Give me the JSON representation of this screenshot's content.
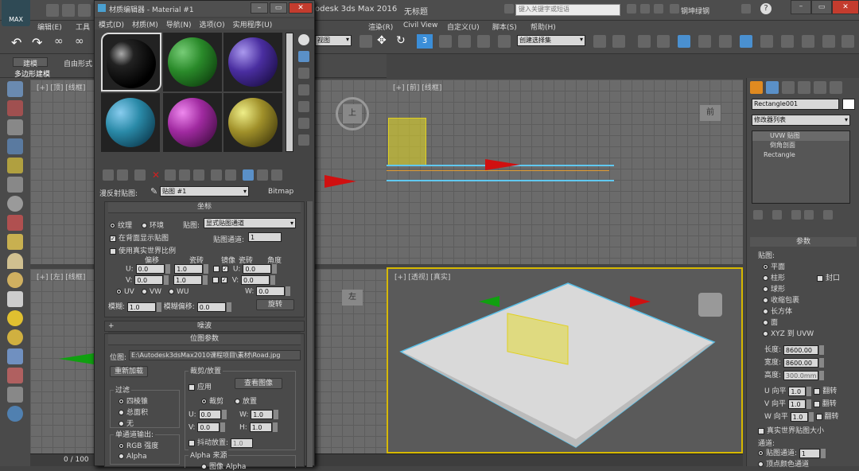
{
  "app": {
    "title_partial": "odesk 3ds Max 2016",
    "doc_title": "无标题",
    "search_placeholder": "键入关键字或短语",
    "user": "钢坤绿钢",
    "logo": "MAX"
  },
  "main_menu": [
    "编辑(E)",
    "工具",
    "渲染(R)",
    "Civil View",
    "自定义(U)",
    "脚本(S)",
    "帮助(H)"
  ],
  "main_toolbar": {
    "view_dropdown": "视图",
    "selection_set": "创建选择集"
  },
  "ribbon": {
    "tab_build": "建模",
    "tab_freeform": "自由形式",
    "poly_label": "多边形建模"
  },
  "viewports": {
    "top": "[+] [顶] [线框]",
    "front": "[+] [前] [线框]",
    "left": "[+] [左] [线框]",
    "persp": "[+] [透视] [真实]"
  },
  "viewcube": {
    "top": "上",
    "front": "前",
    "left": "左"
  },
  "timeline": "0 / 100",
  "mat_editor": {
    "title": "材质编辑器 - Material #1",
    "menu": [
      "模式(D)",
      "材质(M)",
      "导航(N)",
      "选项(O)",
      "实用程序(U)"
    ],
    "map_label": "漫反射贴图:",
    "map_name": "贴图 #1",
    "map_type": "Bitmap",
    "coords": {
      "header": "坐标",
      "texture": "纹理",
      "env": "环境",
      "mapping_label": "贴图:",
      "mapping_value": "显式贴图通道",
      "show_back": "在背面显示贴图",
      "channel_label": "贴图通道:",
      "channel_value": "1",
      "real_world": "使用真实世界比例",
      "h_offset": "偏移",
      "h_tiling": "瓷砖",
      "h_mirror": "镜像",
      "h_tile": "瓷砖",
      "h_angle": "角度",
      "u": "U:",
      "v": "V:",
      "w": "W:",
      "u_offset": "0.0",
      "v_offset": "0.0",
      "u_tiling": "1.0",
      "v_tiling": "1.0",
      "u_angle": "0.0",
      "v_angle": "0.0",
      "w_angle": "0.0",
      "uv": "UV",
      "vw": "VW",
      "wu": "WU",
      "blur_label": "模糊:",
      "blur_value": "1.0",
      "blur_offset_label": "模糊偏移:",
      "blur_offset_value": "0.0",
      "rotate_btn": "旋转"
    },
    "noise_header": "噪波",
    "bitmap": {
      "header": "位图参数",
      "path_label": "位图:",
      "path": "E:\\Autodesk3dsMax2010课程项目\\素材\\Road.jpg",
      "reload": "重新加载",
      "crop_group": "裁剪/放置",
      "apply": "应用",
      "view_image": "查看图像",
      "crop": "裁剪",
      "place": "放置",
      "u": "U:",
      "v": "V:",
      "w": "W:",
      "h": "H:",
      "u_val": "0.0",
      "v_val": "0.0",
      "w_val": "1.0",
      "h_val": "1.0",
      "jitter": "抖动放置:",
      "jitter_val": "1.0",
      "filter_group": "过滤",
      "filter_pyramid": "四棱锥",
      "filter_sum": "总面积",
      "filter_none": "无",
      "mono_group": "单通道输出:",
      "mono_rgb": "RGB 强度",
      "mono_alpha": "Alpha",
      "alpha_group": "Alpha 来源",
      "alpha_img": "图像 Alpha"
    }
  },
  "right_panel": {
    "object_name": "Rectangle001",
    "modifier_list": "修改器列表",
    "stack": [
      "UVW 贴图",
      "倒角剖面",
      "Rectangle"
    ],
    "params_header": "参数",
    "mapping_label": "贴图:",
    "mapping_types": [
      "平面",
      "柱形",
      "球形",
      "收缩包裹",
      "长方体",
      "面",
      "XYZ 到 UVW"
    ],
    "cap": "封口",
    "length_label": "长度:",
    "length": "8600.00",
    "width_label": "宽度:",
    "width": "8600.00",
    "height_label": "高度:",
    "height": "300.0mm",
    "u_tile_label": "U 向平",
    "v_tile_label": "V 向平",
    "w_tile_label": "W 向平",
    "u_tile": "1.0",
    "v_tile": "1.0",
    "w_tile": "1.0",
    "flip": "翻转",
    "real_world": "真实世界贴图大小",
    "channel_group": "通道:",
    "map_channel": "贴图通道:",
    "map_channel_val": "1",
    "vertex_color": "顶点颜色通道"
  },
  "colors": {
    "bg": "#444444",
    "accent": "#f5c400",
    "highlight": "#e8e8e8",
    "axis_red": "#d01010",
    "axis_green": "#10a010"
  }
}
